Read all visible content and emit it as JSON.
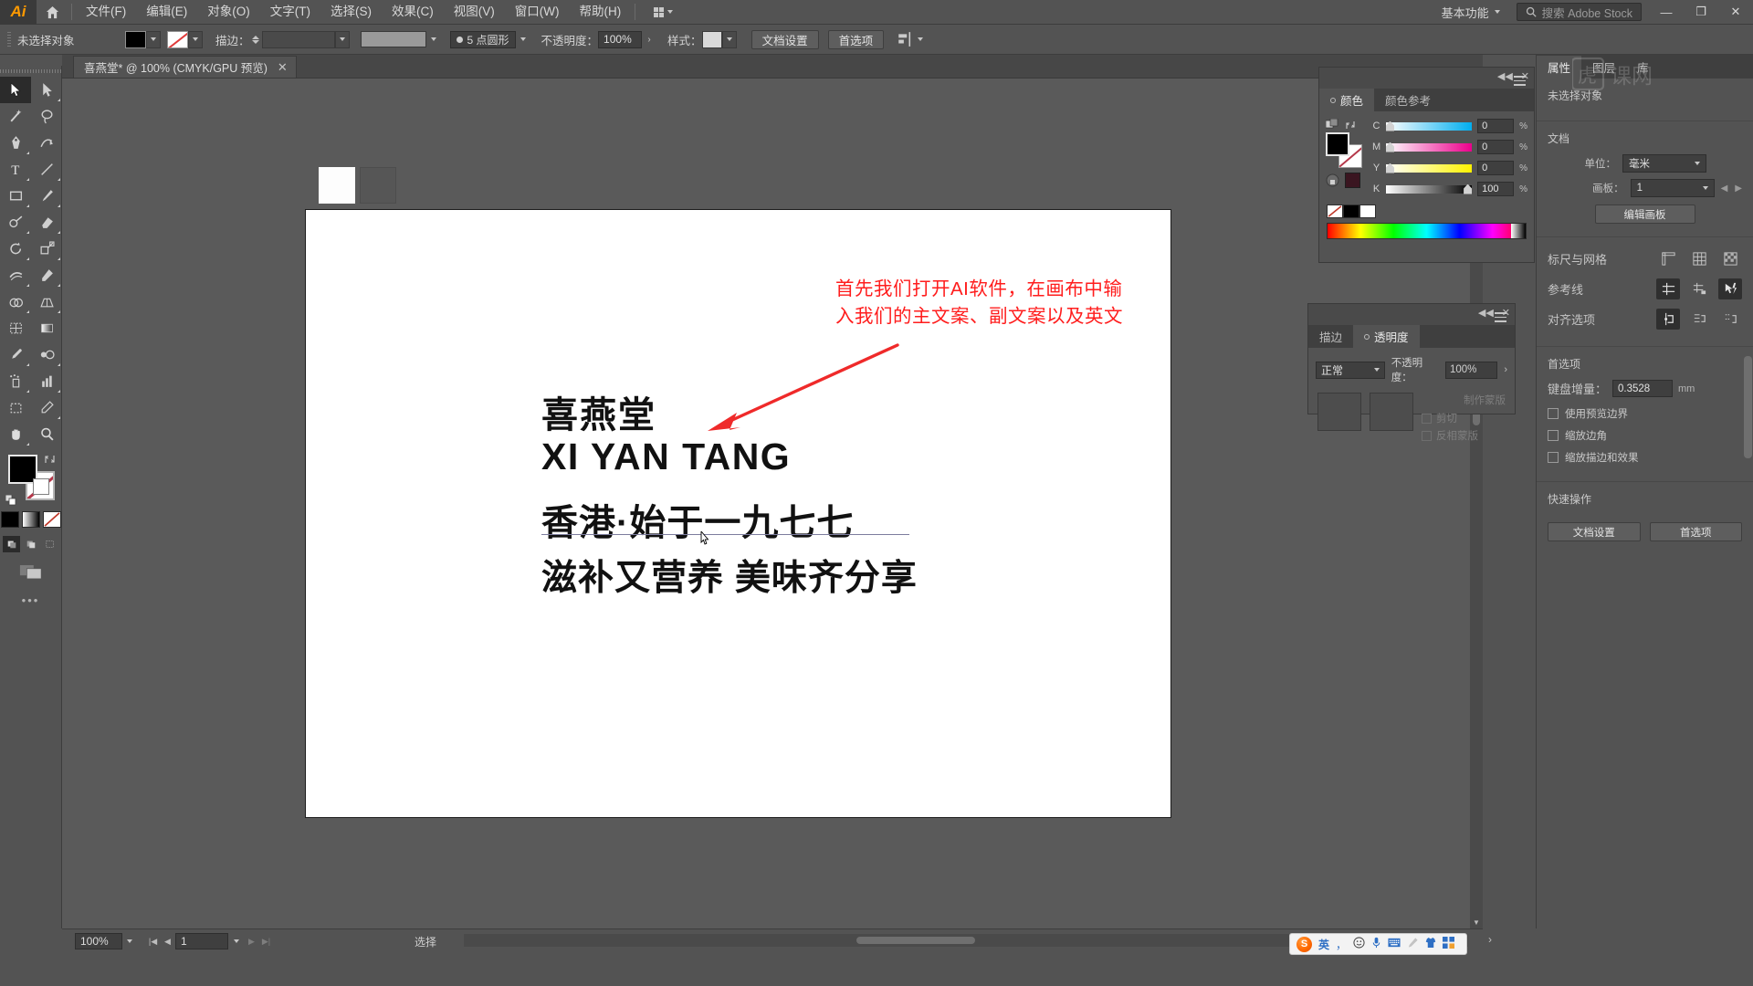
{
  "app": {
    "name": "Adobe Illustrator",
    "logo_text": "Ai"
  },
  "menubar": {
    "items": [
      {
        "label": "文件(F)"
      },
      {
        "label": "编辑(E)"
      },
      {
        "label": "对象(O)"
      },
      {
        "label": "文字(T)"
      },
      {
        "label": "选择(S)"
      },
      {
        "label": "效果(C)"
      },
      {
        "label": "视图(V)"
      },
      {
        "label": "窗口(W)"
      },
      {
        "label": "帮助(H)"
      }
    ],
    "workspace": "基本功能",
    "stock_search": "搜索 Adobe Stock",
    "window_controls": {
      "minimize": "—",
      "maximize": "❐",
      "close": "✕"
    }
  },
  "controlbar": {
    "selection_status": "未选择对象",
    "stroke_label": "描边：",
    "stroke_weight": "",
    "profile_label": "5 点圆形",
    "opacity_label": "不透明度：",
    "opacity_value": "100%",
    "style_label": "样式：",
    "doc_setup": "文档设置",
    "preferences": "首选项"
  },
  "tabstrip": {
    "document_tab": "喜燕堂* @ 100% (CMYK/GPU 预览)",
    "close_glyph": "✕"
  },
  "canvas": {
    "annotation": [
      "首先我们打开AI软件，在画布中输",
      "入我们的主文案、副文案以及英文"
    ],
    "annotation_color": "#ff1d1d",
    "artboard_text": [
      "喜燕堂",
      "XI YAN TANG",
      "香港·始于一九七七",
      "滋补又营养 美味齐分享"
    ]
  },
  "color_panel": {
    "tabs": [
      "颜色",
      "颜色参考"
    ],
    "active_tab": "颜色",
    "sliders": [
      {
        "label": "C",
        "value": "0",
        "unit": "%"
      },
      {
        "label": "M",
        "value": "0",
        "unit": "%"
      },
      {
        "label": "Y",
        "value": "0",
        "unit": "%"
      },
      {
        "label": "K",
        "value": "100",
        "unit": "%"
      }
    ]
  },
  "transparency_panel": {
    "tabs": [
      "描边",
      "透明度"
    ],
    "active_tab": "透明度",
    "blend_mode": "正常",
    "opacity_label": "不透明度：",
    "opacity_value": "100%",
    "make_mask": "制作蒙版",
    "clip": "剪切",
    "invert_mask": "反相蒙版"
  },
  "properties_panel": {
    "tabs": [
      "属性",
      "图层",
      "库"
    ],
    "active_tab": "属性",
    "no_selection": "未选择对象",
    "document_section": {
      "title": "文档",
      "unit_label": "单位：",
      "unit_value": "毫米",
      "artboard_label": "画板：",
      "artboard_value": "1",
      "edit_artboards": "编辑画板"
    },
    "rulers_section": {
      "title": "标尺与网格"
    },
    "guides_section": {
      "title": "参考线"
    },
    "align_section": {
      "title": "对齐选项"
    },
    "preferences_section": {
      "title": "首选项",
      "keyboard_increment_label": "键盘增量：",
      "keyboard_increment_value": "0.3528",
      "keyboard_increment_unit": "mm",
      "checkboxes": [
        "使用预览边界",
        "缩放边角",
        "缩放描边和效果"
      ]
    },
    "quick_actions": {
      "title": "快速操作",
      "buttons": [
        "文档设置",
        "首选项"
      ]
    }
  },
  "statusbar": {
    "zoom": "100%",
    "artboard_number": "1",
    "current_tool": "选择"
  },
  "ime": {
    "logo": "S",
    "mode": "英",
    "items": [
      "，",
      "☺",
      "🎤",
      "⌨",
      "✎",
      "👕",
      "▦"
    ]
  },
  "watermark": "虎课网"
}
